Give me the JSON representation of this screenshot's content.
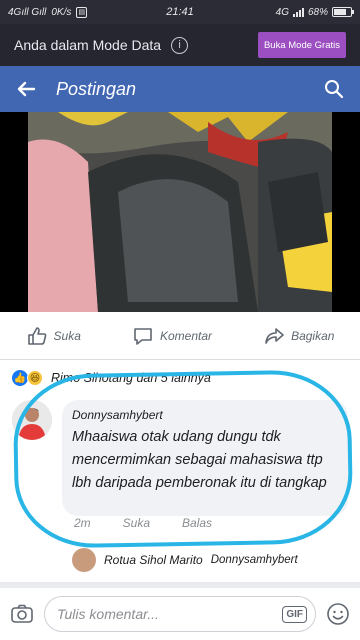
{
  "status_bar": {
    "left": "4Gıll Gıll",
    "speed": "0K/s",
    "time": "21:41",
    "network": "4G",
    "battery": "68%"
  },
  "data_banner": {
    "text": "Anda dalam Mode Data",
    "button": "Buka Mode Gratis"
  },
  "header": {
    "title": "Postingan"
  },
  "actions": {
    "like": "Suka",
    "comment": "Komentar",
    "share": "Bagikan"
  },
  "reactions": {
    "names": "Rimo Sihotang dan 5 lainnya"
  },
  "comment": {
    "author": "Donnysamhybert",
    "text": "Mhaaiswa otak udang dungu tdk mencermimkan sebagai mahasiswa ttp lbh daripada pemberonak itu di tangkap",
    "time": "2m",
    "like": "Suka",
    "reply": "Balas"
  },
  "reply_preview": {
    "name": "Rotua Sihol Marito",
    "snippet": "Donnysamhybert"
  },
  "composer": {
    "placeholder": "Tulis komentar...",
    "gif": "GIF"
  },
  "colors": {
    "header": "#4267b2",
    "banner": "#262631",
    "free_button": "#9b4fc0",
    "highlight": "#29b6e6"
  }
}
